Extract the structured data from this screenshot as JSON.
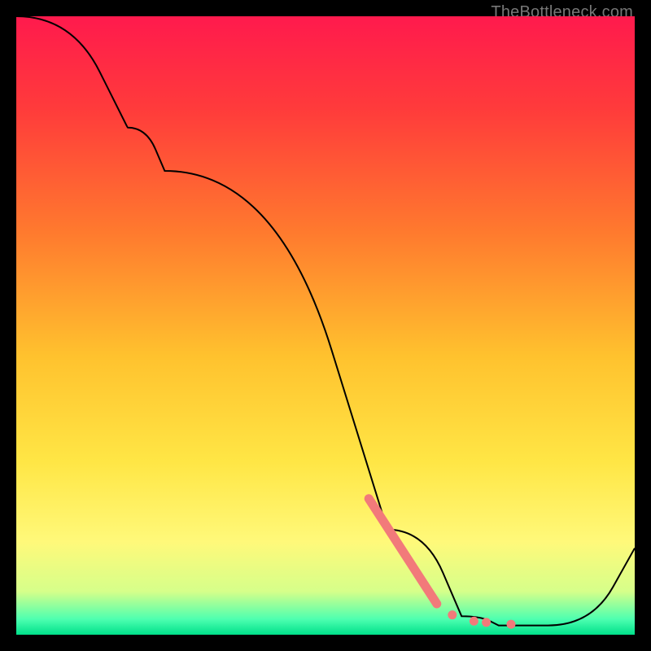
{
  "watermark": "TheBottleneck.com",
  "chart_data": {
    "type": "line",
    "title": "",
    "xlabel": "",
    "ylabel": "",
    "xlim": [
      0,
      100
    ],
    "ylim": [
      0,
      100
    ],
    "grid": false,
    "legend": false,
    "series": [
      {
        "name": "curve",
        "stroke": "#000000",
        "points": [
          {
            "x": 0,
            "y": 100
          },
          {
            "x": 18,
            "y": 82
          },
          {
            "x": 24,
            "y": 75
          },
          {
            "x": 60,
            "y": 17
          },
          {
            "x": 72,
            "y": 3
          },
          {
            "x": 78,
            "y": 1.5
          },
          {
            "x": 86,
            "y": 1.5
          },
          {
            "x": 100,
            "y": 14
          }
        ]
      }
    ],
    "highlight_segment": {
      "color": "#f27a7a",
      "points": [
        {
          "x": 57,
          "y": 22
        },
        {
          "x": 68,
          "y": 5
        }
      ]
    },
    "highlight_dots": {
      "color": "#f27a7a",
      "points": [
        {
          "x": 70.5,
          "y": 3.2
        },
        {
          "x": 74,
          "y": 2.2
        },
        {
          "x": 76,
          "y": 2.0
        },
        {
          "x": 80,
          "y": 1.7
        }
      ]
    },
    "background_gradient": {
      "stops": [
        {
          "offset": 0.0,
          "color": "#ff1a4d"
        },
        {
          "offset": 0.15,
          "color": "#ff3b3b"
        },
        {
          "offset": 0.35,
          "color": "#ff7a2e"
        },
        {
          "offset": 0.55,
          "color": "#ffc22e"
        },
        {
          "offset": 0.72,
          "color": "#ffe645"
        },
        {
          "offset": 0.85,
          "color": "#fff97a"
        },
        {
          "offset": 0.93,
          "color": "#d6ff8a"
        },
        {
          "offset": 0.975,
          "color": "#4dffb0"
        },
        {
          "offset": 1.0,
          "color": "#00e08a"
        }
      ]
    }
  }
}
